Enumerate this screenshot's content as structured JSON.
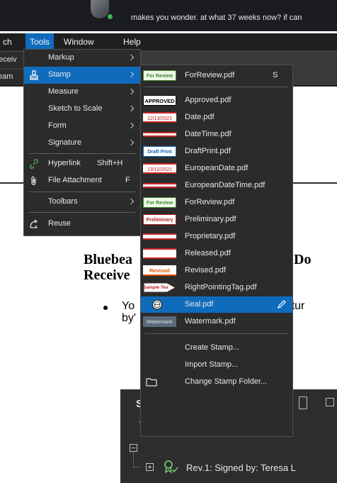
{
  "chat": {
    "message": "makes you wonder.  at what 37 weeks now?  if can"
  },
  "menubar": {
    "search": "ch",
    "tools": "Tools",
    "window": "Window",
    "help": "Help"
  },
  "toolbar": {
    "tab1": "eceiv",
    "tab2": "eam"
  },
  "tools_menu": {
    "items": [
      {
        "label": "Markup",
        "submenu": true
      },
      {
        "label": "Stamp",
        "submenu": true,
        "selected": true
      },
      {
        "label": "Measure",
        "submenu": true
      },
      {
        "label": "Sketch to Scale",
        "submenu": true
      },
      {
        "label": "Form",
        "submenu": true
      },
      {
        "label": "Signature",
        "submenu": true
      },
      {
        "label": "Hyperlink",
        "shortcut": "Shift+H"
      },
      {
        "label": "File Attachment",
        "shortcut": "F"
      },
      {
        "label": "Toolbars",
        "submenu": true
      },
      {
        "label": "Reuse"
      }
    ]
  },
  "stamp_menu": {
    "current": {
      "label": "ForReview.pdf",
      "shortcut": "S",
      "thumb": "For Review"
    },
    "items": [
      {
        "label": "Approved.pdf",
        "thumb": "APPROVED"
      },
      {
        "label": "Date.pdf",
        "thumb": "12/13/2021"
      },
      {
        "label": "DateTime.pdf",
        "thumb": ""
      },
      {
        "label": "DraftPrint.pdf",
        "thumb": "Draft Print"
      },
      {
        "label": "EuropeanDate.pdf",
        "thumb": "13/12/2021"
      },
      {
        "label": "EuropeanDateTime.pdf",
        "thumb": ""
      },
      {
        "label": "ForReview.pdf",
        "thumb": "For Review"
      },
      {
        "label": "Preliminary.pdf",
        "thumb": "Preliminary"
      },
      {
        "label": "Proprietary.pdf",
        "thumb": ""
      },
      {
        "label": "Released.pdf",
        "thumb": ""
      },
      {
        "label": "Revised.pdf",
        "thumb": "Revised"
      },
      {
        "label": "RightPointingTag.pdf",
        "thumb": "Sample Text"
      },
      {
        "label": "Seal.pdf",
        "thumb": "",
        "selected": true
      },
      {
        "label": "Watermark.pdf",
        "thumb": "Watermark"
      }
    ],
    "commands": [
      {
        "label": "Create Stamp..."
      },
      {
        "label": "Import Stamp..."
      },
      {
        "label": "Change Stamp Folder..."
      }
    ]
  },
  "document": {
    "heading_line1_left": "Bluebea",
    "heading_line1_right": "a Do",
    "heading_line2_left": "Receive",
    "text_line1_left": "Yo",
    "text_line1_right": "gnatur",
    "text_line2_left": "by'"
  },
  "signature_panel": {
    "heading": "S",
    "revision": "Rev.1: Signed by: Teresa L"
  },
  "colors": {
    "accent": "#0f6cbd",
    "menu_bg": "#2b2b2b",
    "menubar_bg": "#1f1f1f"
  }
}
